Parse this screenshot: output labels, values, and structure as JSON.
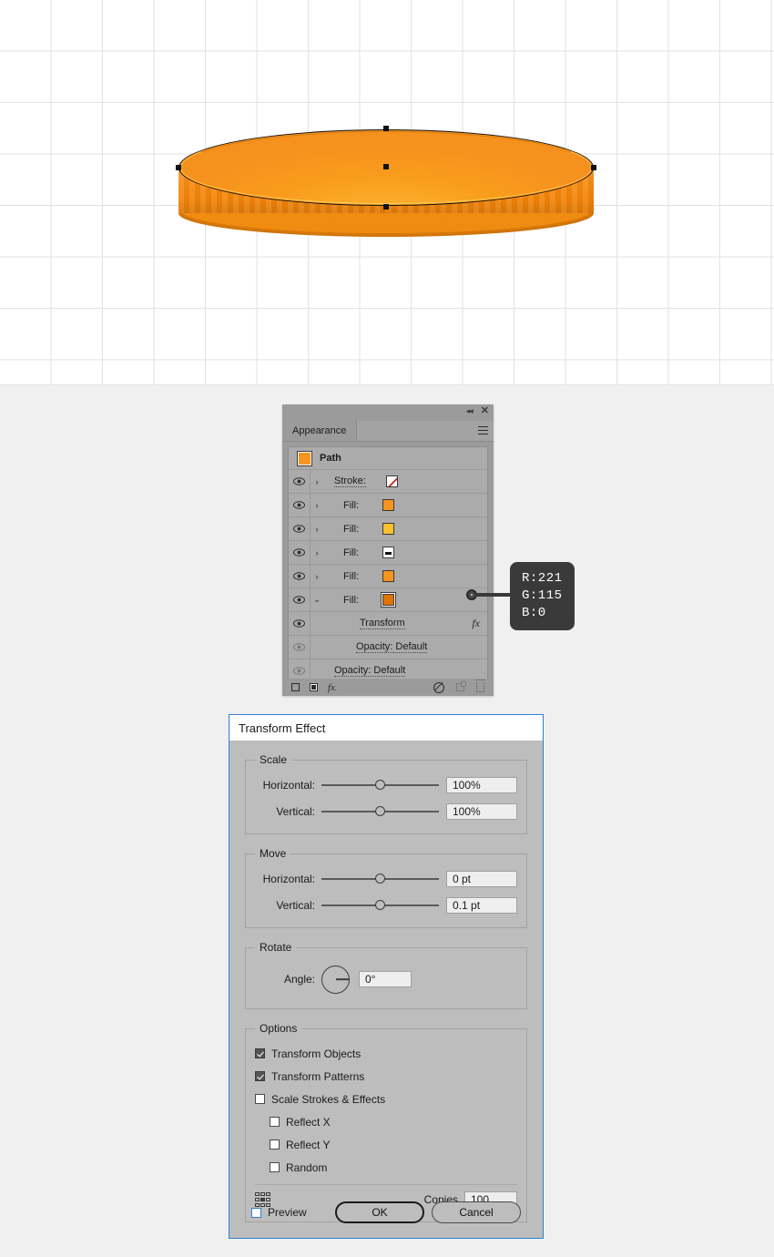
{
  "artwork": {
    "name": "orange-coin-3d-extrude",
    "anchors": [
      "top",
      "center",
      "bottom",
      "left",
      "right"
    ]
  },
  "appearance_panel": {
    "title": "Appearance",
    "close_icon": "✕",
    "collapse_icon": "◂◂",
    "menu_icon": "panel-menu-icon",
    "target_label": "Path",
    "rows": [
      {
        "label": "Stroke:",
        "swatch": "none",
        "color": "#ffffff",
        "eye": true,
        "arrow": "›",
        "expanded": false
      },
      {
        "label": "Fill:",
        "swatch": "solid",
        "color": "#f7941e",
        "eye": true,
        "arrow": "›",
        "expanded": false
      },
      {
        "label": "Fill:",
        "swatch": "solid",
        "color": "#fcc22e",
        "eye": true,
        "arrow": "›",
        "expanded": false
      },
      {
        "label": "Fill:",
        "swatch": "pattern",
        "color": "#ffffff",
        "eye": true,
        "arrow": "›",
        "expanded": false
      },
      {
        "label": "Fill:",
        "swatch": "solid",
        "color": "#f7941e",
        "eye": true,
        "arrow": "›",
        "expanded": false
      },
      {
        "label": "Fill:",
        "swatch": "selected",
        "color": "#dd7300",
        "eye": true,
        "arrow": "⌄",
        "expanded": true
      },
      {
        "label": "Transform",
        "swatch": null,
        "eye": true,
        "fx": "fx",
        "indent": 1
      },
      {
        "label": "Opacity:  Default",
        "swatch": null,
        "eye": false,
        "indent": 2
      },
      {
        "label": "Opacity:  Default",
        "swatch": null,
        "eye": false,
        "indent": 1
      }
    ],
    "footer_icons": [
      "add-new-stroke-icon",
      "add-new-fill-icon",
      "add-new-effect-icon",
      "clear-appearance-icon",
      "duplicate-item-icon",
      "delete-item-icon"
    ]
  },
  "callout": {
    "r_line": "R:221",
    "g_line": "G:115",
    "b_line": "B:0",
    "color_hex": "#dd7300"
  },
  "dialog": {
    "title": "Transform Effect",
    "scale": {
      "legend": "Scale",
      "horizontal_label": "Horizontal:",
      "horizontal_value": "100%",
      "vertical_label": "Vertical:",
      "vertical_value": "100%"
    },
    "move": {
      "legend": "Move",
      "horizontal_label": "Horizontal:",
      "horizontal_value": "0 pt",
      "vertical_label": "Vertical:",
      "vertical_value": "0.1 pt"
    },
    "rotate": {
      "legend": "Rotate",
      "angle_label": "Angle:",
      "angle_value": "0°"
    },
    "options": {
      "legend": "Options",
      "transform_objects": {
        "label": "Transform Objects",
        "checked": true
      },
      "transform_patterns": {
        "label": "Transform Patterns",
        "checked": true
      },
      "scale_strokes": {
        "label": "Scale Strokes & Effects",
        "checked": false
      },
      "reflect_x": {
        "label": "Reflect X",
        "checked": false
      },
      "reflect_y": {
        "label": "Reflect Y",
        "checked": false
      },
      "random": {
        "label": "Random",
        "checked": false
      },
      "copies_label": "Copies",
      "copies_value": "100",
      "reference_point": "center"
    },
    "preview_label": "Preview",
    "preview_checked": false,
    "ok_label": "OK",
    "cancel_label": "Cancel"
  }
}
